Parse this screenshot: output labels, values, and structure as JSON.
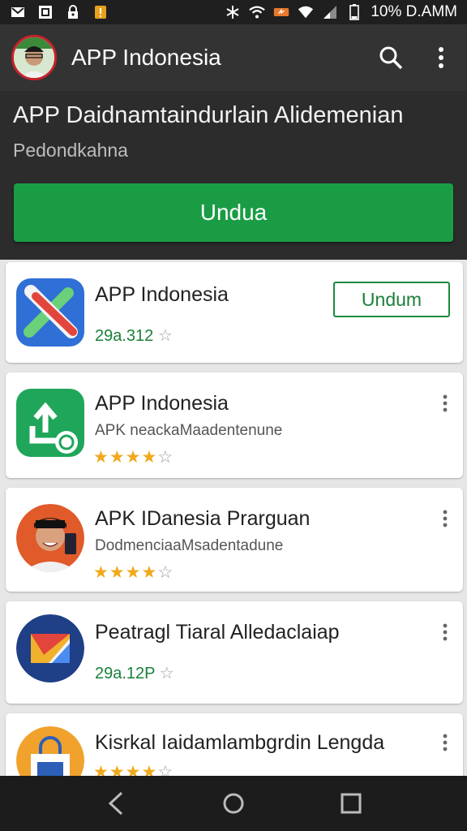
{
  "status_bar": {
    "left_icons": [
      "mail-icon",
      "image-icon",
      "lock-icon",
      "warning-icon"
    ],
    "right_icons": [
      "bluetooth-icon",
      "wifi-icon",
      "battery-saver-icon",
      "signal-icon",
      "battery-icon"
    ],
    "battery_text": "10% D.AMM"
  },
  "app_bar": {
    "title": "APP Indonesia",
    "search_icon": "search-icon",
    "more_icon": "more-vert-icon"
  },
  "hero": {
    "headline": "APP Daidnamtaindurlain Alidemenian",
    "subtitle": "Pedondkahna",
    "cta_label": "Undua"
  },
  "apps": [
    {
      "name": "APP Indonesia",
      "price": "29a.312",
      "install_label": "Undum",
      "icon": "tools-app-icon"
    },
    {
      "name": "APP Indonesia",
      "meta": "APK neackaMaadentenune",
      "rating": 4,
      "rating_max": 5,
      "icon": "upload-app-icon"
    },
    {
      "name": "APK IDanesia Prarguan",
      "meta": "DodmenciaaMsadentadune",
      "rating": 4,
      "rating_max": 5,
      "icon": "person-app-icon"
    },
    {
      "name": "Peatragl Tiaral Alledaclaiap",
      "price": "29a.12P",
      "icon": "envelope-app-icon"
    },
    {
      "name": "Kisrkal Iaidamlambgrdin Lengda",
      "rating": 4,
      "rating_max": 5,
      "icon": "shopping-bag-app-icon"
    }
  ],
  "colors": {
    "accent_green": "#1a9c45",
    "star": "#f0a81c",
    "app_bar": "#333333",
    "status_bar": "#1f1f1f",
    "nav_bar": "#1c1c1c"
  },
  "nav_bar": {
    "buttons": [
      "back-icon",
      "home-icon",
      "recents-icon"
    ]
  }
}
